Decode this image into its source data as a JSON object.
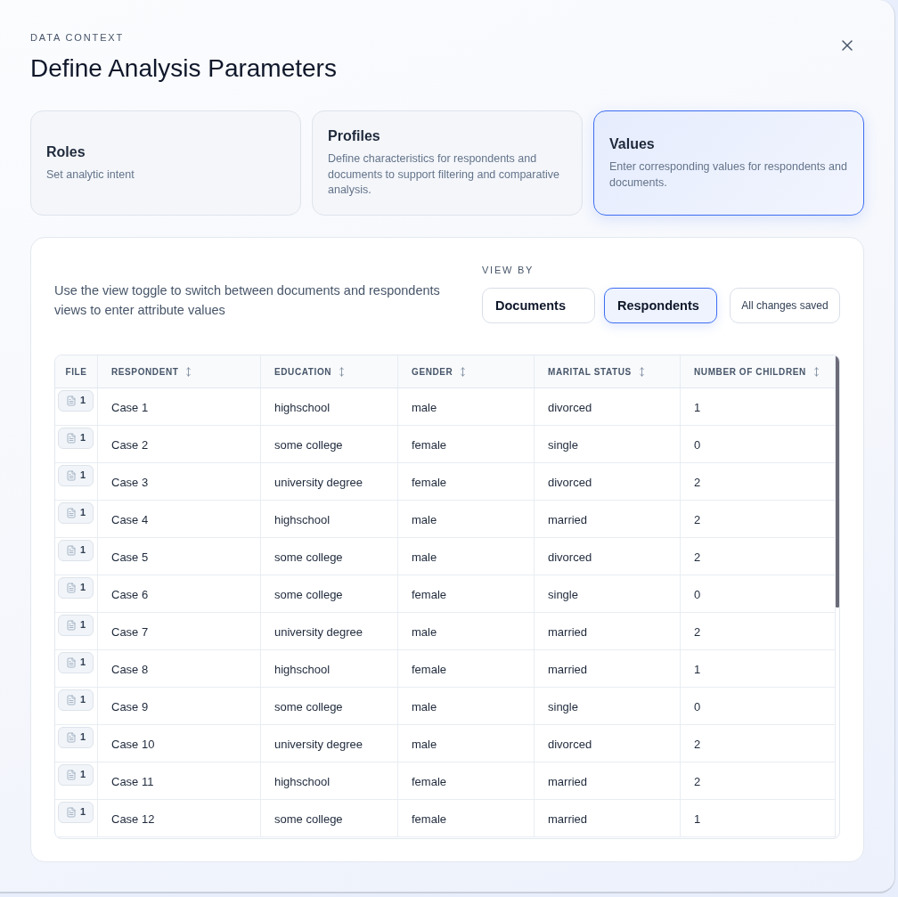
{
  "header": {
    "eyebrow": "DATA CONTEXT",
    "title": "Define Analysis Parameters"
  },
  "steps": [
    {
      "title": "Roles",
      "description": "Set analytic intent",
      "selected": false
    },
    {
      "title": "Profiles",
      "description": "Define characteristics for respondents and documents to support filtering and comparative analysis.",
      "selected": false
    },
    {
      "title": "Values",
      "description": "Enter corresponding values for respondents and documents.",
      "selected": true
    }
  ],
  "panel": {
    "instructions": "Use the view toggle to switch between documents and respondents views to enter attribute values",
    "view_by": {
      "label": "VIEW BY",
      "options": [
        {
          "label": "Documents",
          "selected": false
        },
        {
          "label": "Respondents",
          "selected": true
        }
      ]
    },
    "save_status": "All changes saved"
  },
  "table": {
    "columns": [
      {
        "label": "FILE",
        "kind": "file",
        "sortable": false
      },
      {
        "label": "RESPONDENT",
        "kind": "text",
        "sortable": true
      },
      {
        "label": "EDUCATION",
        "kind": "text",
        "sortable": true
      },
      {
        "label": "GENDER",
        "kind": "text",
        "sortable": true
      },
      {
        "label": "MARITAL STATUS",
        "kind": "text",
        "sortable": true
      },
      {
        "label": "NUMBER OF CHILDREN",
        "kind": "text",
        "sortable": true
      }
    ],
    "rows": [
      [
        "1",
        "Case 1",
        "highschool",
        "male",
        "divorced",
        "1"
      ],
      [
        "1",
        "Case 2",
        "some college",
        "female",
        "single",
        "0"
      ],
      [
        "1",
        "Case 3",
        "university degree",
        "female",
        "divorced",
        "2"
      ],
      [
        "1",
        "Case 4",
        "highschool",
        "male",
        "married",
        "2"
      ],
      [
        "1",
        "Case 5",
        "some college",
        "male",
        "divorced",
        "2"
      ],
      [
        "1",
        "Case 6",
        "some college",
        "female",
        "single",
        "0"
      ],
      [
        "1",
        "Case 7",
        "university degree",
        "male",
        "married",
        "2"
      ],
      [
        "1",
        "Case 8",
        "highschool",
        "female",
        "married",
        "1"
      ],
      [
        "1",
        "Case 9",
        "some college",
        "male",
        "single",
        "0"
      ],
      [
        "1",
        "Case 10",
        "university degree",
        "male",
        "divorced",
        "2"
      ],
      [
        "1",
        "Case 11",
        "highschool",
        "female",
        "married",
        "2"
      ],
      [
        "1",
        "Case 12",
        "some college",
        "female",
        "married",
        "1"
      ]
    ]
  }
}
